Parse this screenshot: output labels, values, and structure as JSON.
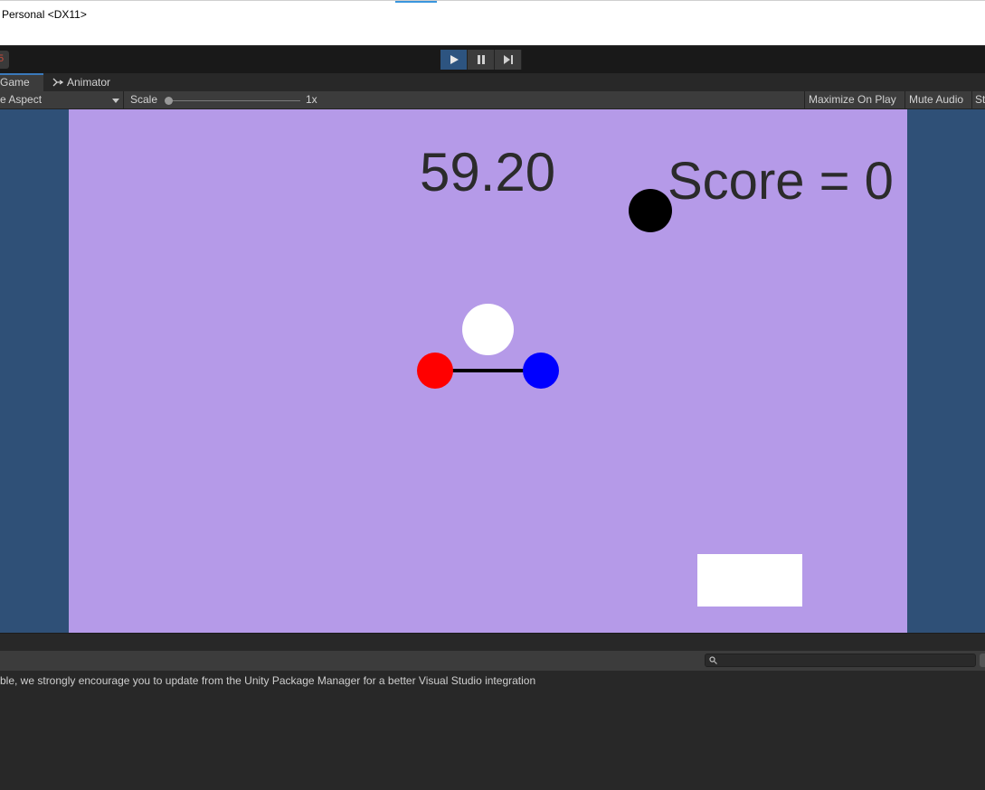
{
  "window": {
    "title": "Personal  <DX11>"
  },
  "toolbar": {
    "left_stub": "5",
    "play_icon": "play-icon",
    "pause_icon": "pause-icon",
    "step_icon": "step-icon",
    "accent": "#2d5480"
  },
  "tabs": [
    {
      "label": "Game",
      "active": true
    },
    {
      "label": "Animator",
      "icon": "animator-icon"
    }
  ],
  "gamebar": {
    "aspect": "e Aspect",
    "scale_label": "Scale",
    "scale_value": "1x",
    "maximize": "Maximize On Play",
    "mute": "Mute Audio",
    "stats": "St"
  },
  "game": {
    "timer": "59.20",
    "score": "Score = 0",
    "background": "#b59ae8",
    "outer_background": "#2f5077"
  },
  "console": {
    "search_placeholder": "",
    "message": "ble, we strongly encourage you to update from the Unity Package Manager for a better Visual Studio integration"
  }
}
